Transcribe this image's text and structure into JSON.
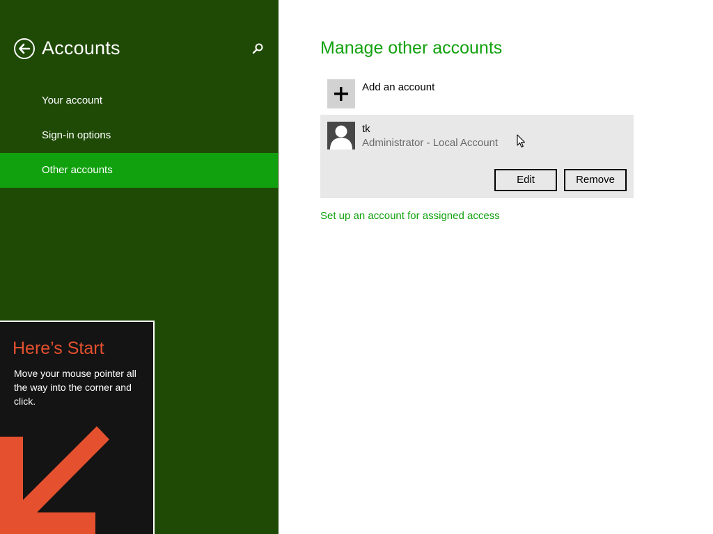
{
  "nav": {
    "title": "Accounts",
    "items": [
      {
        "label": "Your account",
        "selected": false
      },
      {
        "label": "Sign-in options",
        "selected": false
      },
      {
        "label": "Other accounts",
        "selected": true
      }
    ]
  },
  "start_tip": {
    "title": "Here’s Start",
    "body": "Move your mouse pointer all the way into the corner and click."
  },
  "main": {
    "title": "Manage other accounts",
    "add_account_label": "Add an account",
    "account": {
      "name": "tk",
      "type": "Administrator - Local Account",
      "edit_label": "Edit",
      "remove_label": "Remove"
    },
    "assigned_access_link": "Set up an account for assigned access"
  },
  "icons": {
    "back": "back-arrow-icon",
    "search": "search-icon",
    "add": "plus-icon",
    "avatar": "user-silhouette-icon",
    "tip_arrow": "diagonal-arrow-icon",
    "cursor": "mouse-pointer-icon"
  },
  "colors": {
    "nav_background": "#1f4a06",
    "accent": "#11a10e",
    "tip_title": "#e5512f",
    "tip_arrow": "#e5512f",
    "tip_background": "#141414",
    "card_background": "#e8e8e8"
  }
}
